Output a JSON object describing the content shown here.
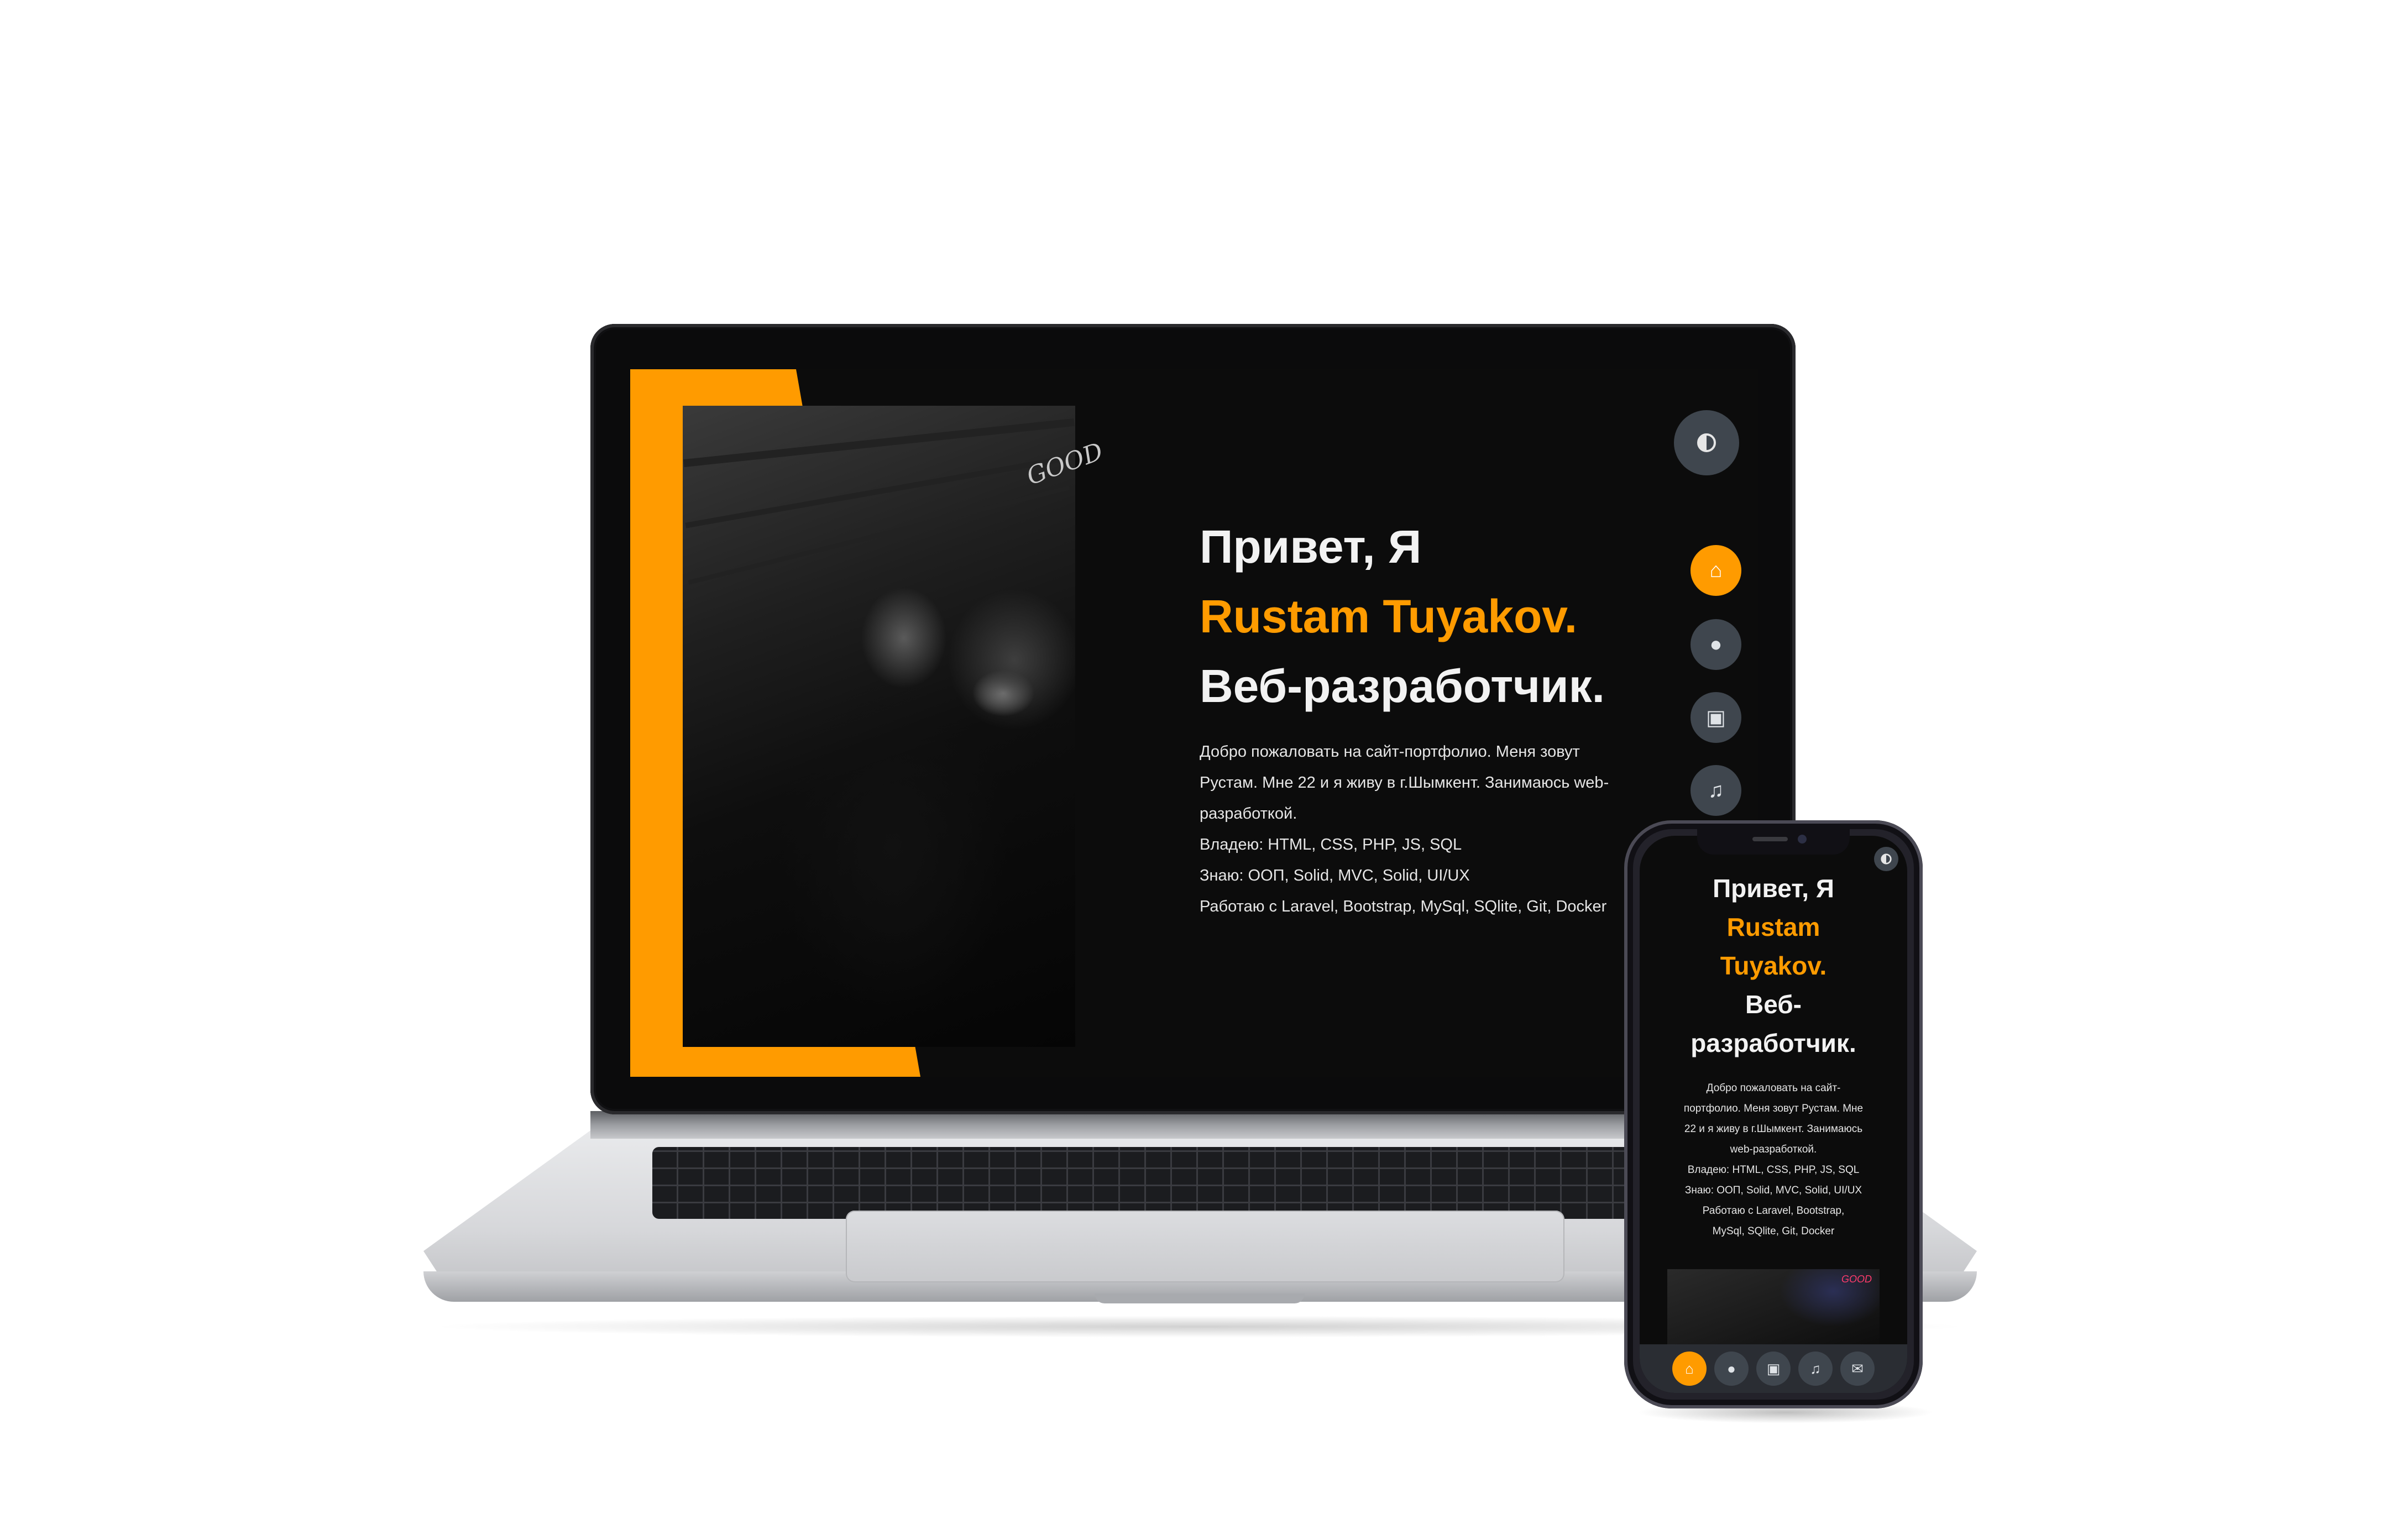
{
  "colors": {
    "accent": "#ff9b00",
    "background": "#0c0c0c",
    "nav_button": "#3f464e",
    "text": "#f2f2f2"
  },
  "desktop": {
    "photo_sign": "GOOD",
    "hero": {
      "greeting": "Привет, Я",
      "name": "Rustam Tuyakov.",
      "role": "Веб-разработчик.",
      "intro_lines": [
        "Добро пожаловать на сайт-портфолио. Меня зовут",
        "Рустам. Мне 22 и я живу в г.Шымкент. Занимаюсь web-",
        "разработкой.",
        "Владею: HTML, CSS, PHP, JS, SQL",
        "Знаю: ООП, Solid, MVC, Solid, UI/UX",
        "Работаю с Laravel, Bootstrap, MySql, SQlite, Git, Docker"
      ]
    },
    "nav": [
      {
        "icon": "home-icon",
        "glyph": "⌂",
        "active": true
      },
      {
        "icon": "user-icon",
        "glyph": "●",
        "active": false
      },
      {
        "icon": "briefcase-icon",
        "glyph": "▣",
        "active": false
      },
      {
        "icon": "music-icon",
        "glyph": "♫",
        "active": false
      }
    ]
  },
  "mobile": {
    "hero": {
      "greeting": "Привет, Я",
      "name_line1": "Rustam",
      "name_line2": "Tuyakov.",
      "role_line1": "Веб-",
      "role_line2": "разработчик.",
      "intro_lines": [
        "Добро пожаловать на сайт-",
        "портфолио. Меня зовут Рустам. Мне",
        "22 и я живу в г.Шымкент. Занимаюсь",
        "web-разработкой.",
        "Владею: HTML, CSS, PHP, JS, SQL",
        "Знаю: ООП, Solid, MVC, Solid, UI/UX",
        "Работаю с Laravel, Bootstrap,",
        "MySql, SQlite, Git, Docker"
      ]
    },
    "photo_sign": "GOOD",
    "nav": [
      {
        "icon": "home-icon",
        "glyph": "⌂",
        "active": true
      },
      {
        "icon": "user-icon",
        "glyph": "●",
        "active": false
      },
      {
        "icon": "briefcase-icon",
        "glyph": "▣",
        "active": false
      },
      {
        "icon": "music-icon",
        "glyph": "♫",
        "active": false
      },
      {
        "icon": "mail-icon",
        "glyph": "✉",
        "active": false
      }
    ]
  }
}
